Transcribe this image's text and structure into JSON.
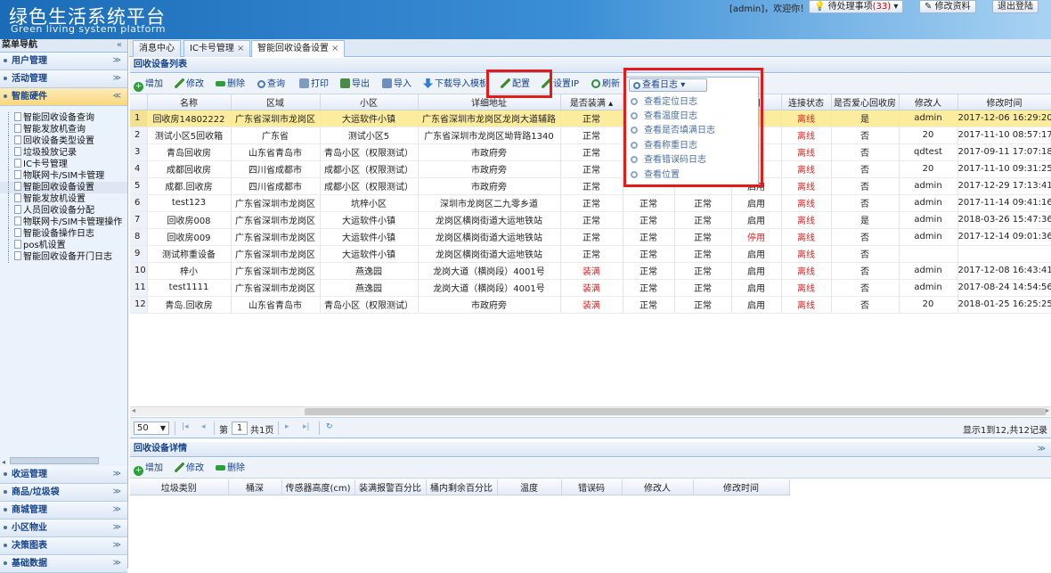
{
  "header": {
    "title_cn": "绿色生活系统平台",
    "title_en": "Green living system platform",
    "user_text": "[admin]，欢迎你！",
    "todo_label": "待处理事项",
    "todo_count": "(33)",
    "edit_profile": "修改资料",
    "logout": "退出登陆"
  },
  "sidebar": {
    "title": "菜单导航",
    "collapse": "«",
    "top_groups": [
      "用户管理",
      "活动管理",
      "智能硬件"
    ],
    "tree_items": [
      "智能回收设备查询",
      "智能发放机查询",
      "回收设备类型设置",
      "垃圾投放记录",
      "IC卡号管理",
      "物联网卡/SIM卡管理",
      "智能回收设备设置",
      "智能发放机设置",
      "人员回收设备分配",
      "物联网卡/SIM卡管理操作",
      "智能设备操作日志",
      "pos机设置",
      "智能回收设备开门日志"
    ],
    "bottom_groups": [
      "收运管理",
      "商品/垃圾袋",
      "商城管理",
      "小区物业",
      "决策图表",
      "基础数据"
    ]
  },
  "tabs": [
    "消息中心",
    "IC卡号管理",
    "智能回收设备设置"
  ],
  "list_panel": {
    "title": "回收设备列表",
    "toolbar": [
      "增加",
      "修改",
      "删除",
      "查询",
      "打印",
      "导出",
      "导入",
      "下载导入模板",
      "配置",
      "设置IP",
      "刷新"
    ],
    "log_button": "查看日志",
    "log_menu": [
      "查看定位日志",
      "查看温度日志",
      "查看是否填满日志",
      "查看称重日志",
      "查看错误码日志",
      "查看位置"
    ]
  },
  "table": {
    "headers": [
      "",
      "名称",
      "区域",
      "小区",
      "详细地址",
      "是否装满",
      "",
      "",
      "用",
      "连接状态",
      "是否爱心回收房",
      "修改人",
      "修改时间"
    ],
    "rows": [
      [
        "1",
        "回收房14802222",
        "广东省深圳市龙岗区",
        "大运软件小镇",
        "广东省深圳市龙岗区龙岗大道辅路",
        "正常",
        "",
        "",
        "",
        "离线",
        "是",
        "admin",
        "2017-12-06 16:29:20"
      ],
      [
        "2",
        "测试小区5回收箱",
        "广东省",
        "测试小区5",
        "广东省深圳市龙岗区坳背路1340",
        "正常",
        "",
        "",
        "",
        "离线",
        "否",
        "20",
        "2017-11-10 08:57:17"
      ],
      [
        "3",
        "青岛回收房",
        "山东省青岛市",
        "青岛小区（权限测试）",
        "市政府旁",
        "正常",
        "",
        "",
        "",
        "离线",
        "否",
        "qdtest",
        "2017-09-11 17:07:18"
      ],
      [
        "4",
        "成都回收房",
        "四川省成都市",
        "成都小区（权限测试）",
        "市政府旁",
        "正常",
        "",
        "",
        "",
        "离线",
        "否",
        "20",
        "2017-11-10 09:31:25"
      ],
      [
        "5",
        "成都.回收房",
        "四川省成都市",
        "成都小区（权限测试）",
        "市政府旁",
        "正常",
        "",
        "",
        "启用",
        "离线",
        "否",
        "admin",
        "2017-12-29 17:13:41"
      ],
      [
        "6",
        "test123",
        "广东省深圳市龙岗区",
        "坑梓小区",
        "深圳市龙岗区二九零乡道",
        "正常",
        "正常",
        "正常",
        "启用",
        "离线",
        "否",
        "admin",
        "2017-11-14 09:41:16"
      ],
      [
        "7",
        "回收房008",
        "广东省深圳市龙岗区",
        "大运软件小镇",
        "龙岗区横岗街道大运地铁站",
        "正常",
        "正常",
        "正常",
        "启用",
        "离线",
        "是",
        "admin",
        "2018-03-26 15:47:36"
      ],
      [
        "8",
        "回收房009",
        "广东省深圳市龙岗区",
        "大运软件小镇",
        "龙岗区横岗街道大运地铁站",
        "正常",
        "正常",
        "正常",
        "停用",
        "离线",
        "否",
        "admin",
        "2017-12-14 09:01:36"
      ],
      [
        "9",
        "测试称重设备",
        "广东省深圳市龙岗区",
        "大运软件小镇",
        "龙岗区横岗街道大运地铁站",
        "正常",
        "正常",
        "正常",
        "启用",
        "离线",
        "否",
        "",
        ""
      ],
      [
        "10",
        "梓小",
        "广东省深圳市龙岗区",
        "燕逸园",
        "龙岗大道（横岗段）4001号",
        "装满",
        "正常",
        "正常",
        "启用",
        "离线",
        "否",
        "admin",
        "2017-12-08 16:43:41"
      ],
      [
        "11",
        "test1111",
        "广东省深圳市龙岗区",
        "燕逸园",
        "龙岗大道（横岗段）4001号",
        "装满",
        "正常",
        "正常",
        "启用",
        "离线",
        "否",
        "admin",
        "2017-08-24 14:54:56"
      ],
      [
        "12",
        "青岛.回收房",
        "山东省青岛市",
        "青岛小区（权限测试）",
        "市政府旁",
        "装满",
        "正常",
        "正常",
        "启用",
        "离线",
        "否",
        "20",
        "2018-01-25 16:25:25"
      ]
    ]
  },
  "pager": {
    "page_size": "50",
    "page_prefix": "第",
    "page_value": "1",
    "page_suffix": "共1页",
    "info": "显示1到12,共12记录"
  },
  "detail_panel": {
    "title": "回收设备详情",
    "toolbar": [
      "增加",
      "修改",
      "删除"
    ],
    "headers": [
      "垃圾类别",
      "桶深",
      "传感器高度(cm)",
      "装满报警百分比",
      "桶内剩余百分比",
      "温度",
      "错误码",
      "修改人",
      "修改时间"
    ]
  },
  "colors": {
    "header_blue": "#1b6cb8",
    "highlight_row": "#fbec9e",
    "alert_red": "#d92020",
    "box_red": "#e31b1b"
  }
}
